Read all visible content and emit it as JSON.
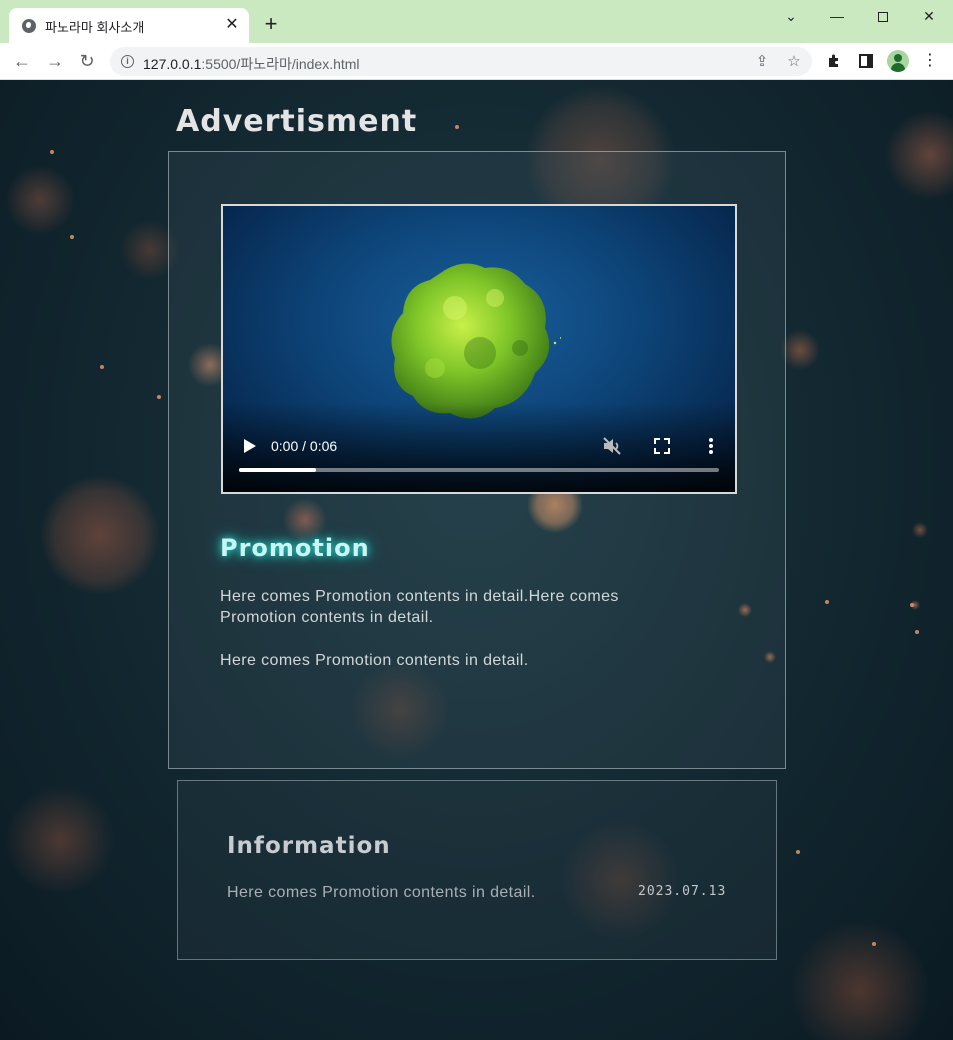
{
  "browser": {
    "tab_title": "파노라마 회사소개",
    "url_host": "127.0.0.1",
    "url_rest": ":5500/파노라마/index.html"
  },
  "page": {
    "heading": "Advertisment",
    "video": {
      "time": "0:00 / 0:06",
      "progress_fraction": 0.16
    },
    "promotion": {
      "title": "Promotion",
      "paragraph1": "Here comes Promotion contents in detail.Here comes Promotion contents in detail.",
      "paragraph2": "Here comes Promotion contents in detail."
    },
    "information": {
      "title": "Information",
      "text": "Here comes Promotion contents in detail.",
      "date": "2023.07.13"
    }
  },
  "colors": {
    "tabbar": "#cbe9c1",
    "promo_glow": "#2bd9d0",
    "background": "#0f2028"
  }
}
